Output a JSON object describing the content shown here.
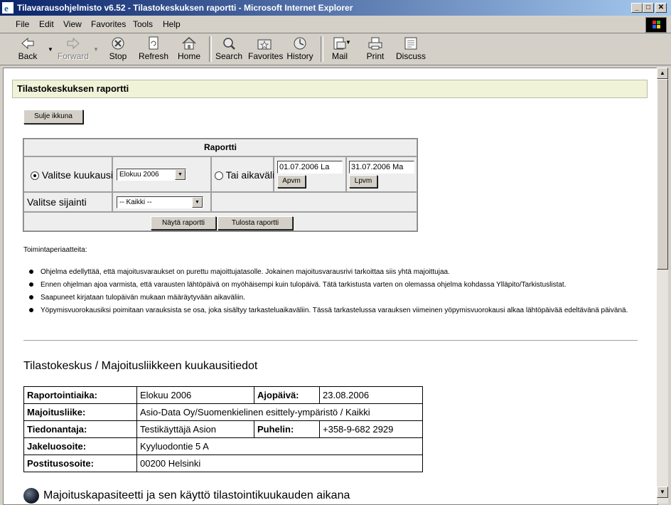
{
  "window": {
    "title": "Tilavarausohjelmisto v6.52 - Tilastokeskuksen raportti - Microsoft Internet Explorer",
    "minimize": "_",
    "restore": "□",
    "close": "✕"
  },
  "menu": [
    "File",
    "Edit",
    "View",
    "Favorites",
    "Tools",
    "Help"
  ],
  "toolbar": {
    "back": "Back",
    "forward": "Forward",
    "stop": "Stop",
    "refresh": "Refresh",
    "home": "Home",
    "search": "Search",
    "favorites": "Favorites",
    "history": "History",
    "mail": "Mail",
    "print": "Print",
    "discuss": "Discuss"
  },
  "page": {
    "header": "Tilastokeskuksen raportti",
    "close_button": "Sulje ikkuna",
    "report": {
      "title": "Raportti",
      "month_label": "Valitse kuukausi",
      "month_value": "Elokuu 2006",
      "range_label": "Tai aikaväli",
      "start_date": "01.07.2006 La",
      "start_button": "Apvm",
      "end_date": "31.07.2006 Ma",
      "end_button": "Lpvm",
      "location_label": "Valitse sijainti",
      "location_value": "-- Kaikki --",
      "show_button": "Näytä raportti",
      "print_button": "Tulosta raportti"
    },
    "principles_heading": "Toimintaperiaatteita:",
    "principles": [
      "Ohjelma edellyttää, että majoitusvaraukset on purettu majoittujatasolle. Jokainen majoitusvarausrivi tarkoittaa siis yhtä majoittujaa.",
      "Ennen ohjelman ajoa varmista, että varausten lähtöpäivä on myöhäisempi kuin tulopäivä. Tätä tarkistusta varten on olemassa ohjelma kohdassa Ylläpito/Tarkistuslistat.",
      "Saapuneet kirjataan tulopäivän mukaan määräytyvään aikaväliin.",
      "Yöpymisvuorokausiksi poimitaan varauksista se osa, joka sisältyy tarkasteluaikaväliin. Tässä tarkastelussa varauksen viimeinen yöpymisvuorokausi alkaa lähtöpäivää edeltävänä päivänä."
    ],
    "section_title": "Tilastokeskus / Majoitusliikkeen kuukausitiedot",
    "info": {
      "period_label": "Raportointiaika:",
      "period_value": "Elokuu 2006",
      "run_label": "Ajopäivä:",
      "run_value": "23.08.2006",
      "business_label": "Majoitusliike:",
      "business_value": "Asio-Data Oy/Suomenkielinen esittely-ympäristö / Kaikki",
      "reporter_label": "Tiedonantaja:",
      "reporter_value": "Testikäyttäjä Asion",
      "phone_label": "Puhelin:",
      "phone_value": "+358-9-682 2929",
      "delivery_label": "Jakeluosoite:",
      "delivery_value": "Kyyluodontie 5 A",
      "postal_label": "Postitusosoite:",
      "postal_value": "00200 Helsinki"
    },
    "next_section": "Majoituskapasiteetti ja sen käyttö tilastointikuukauden aikana"
  }
}
